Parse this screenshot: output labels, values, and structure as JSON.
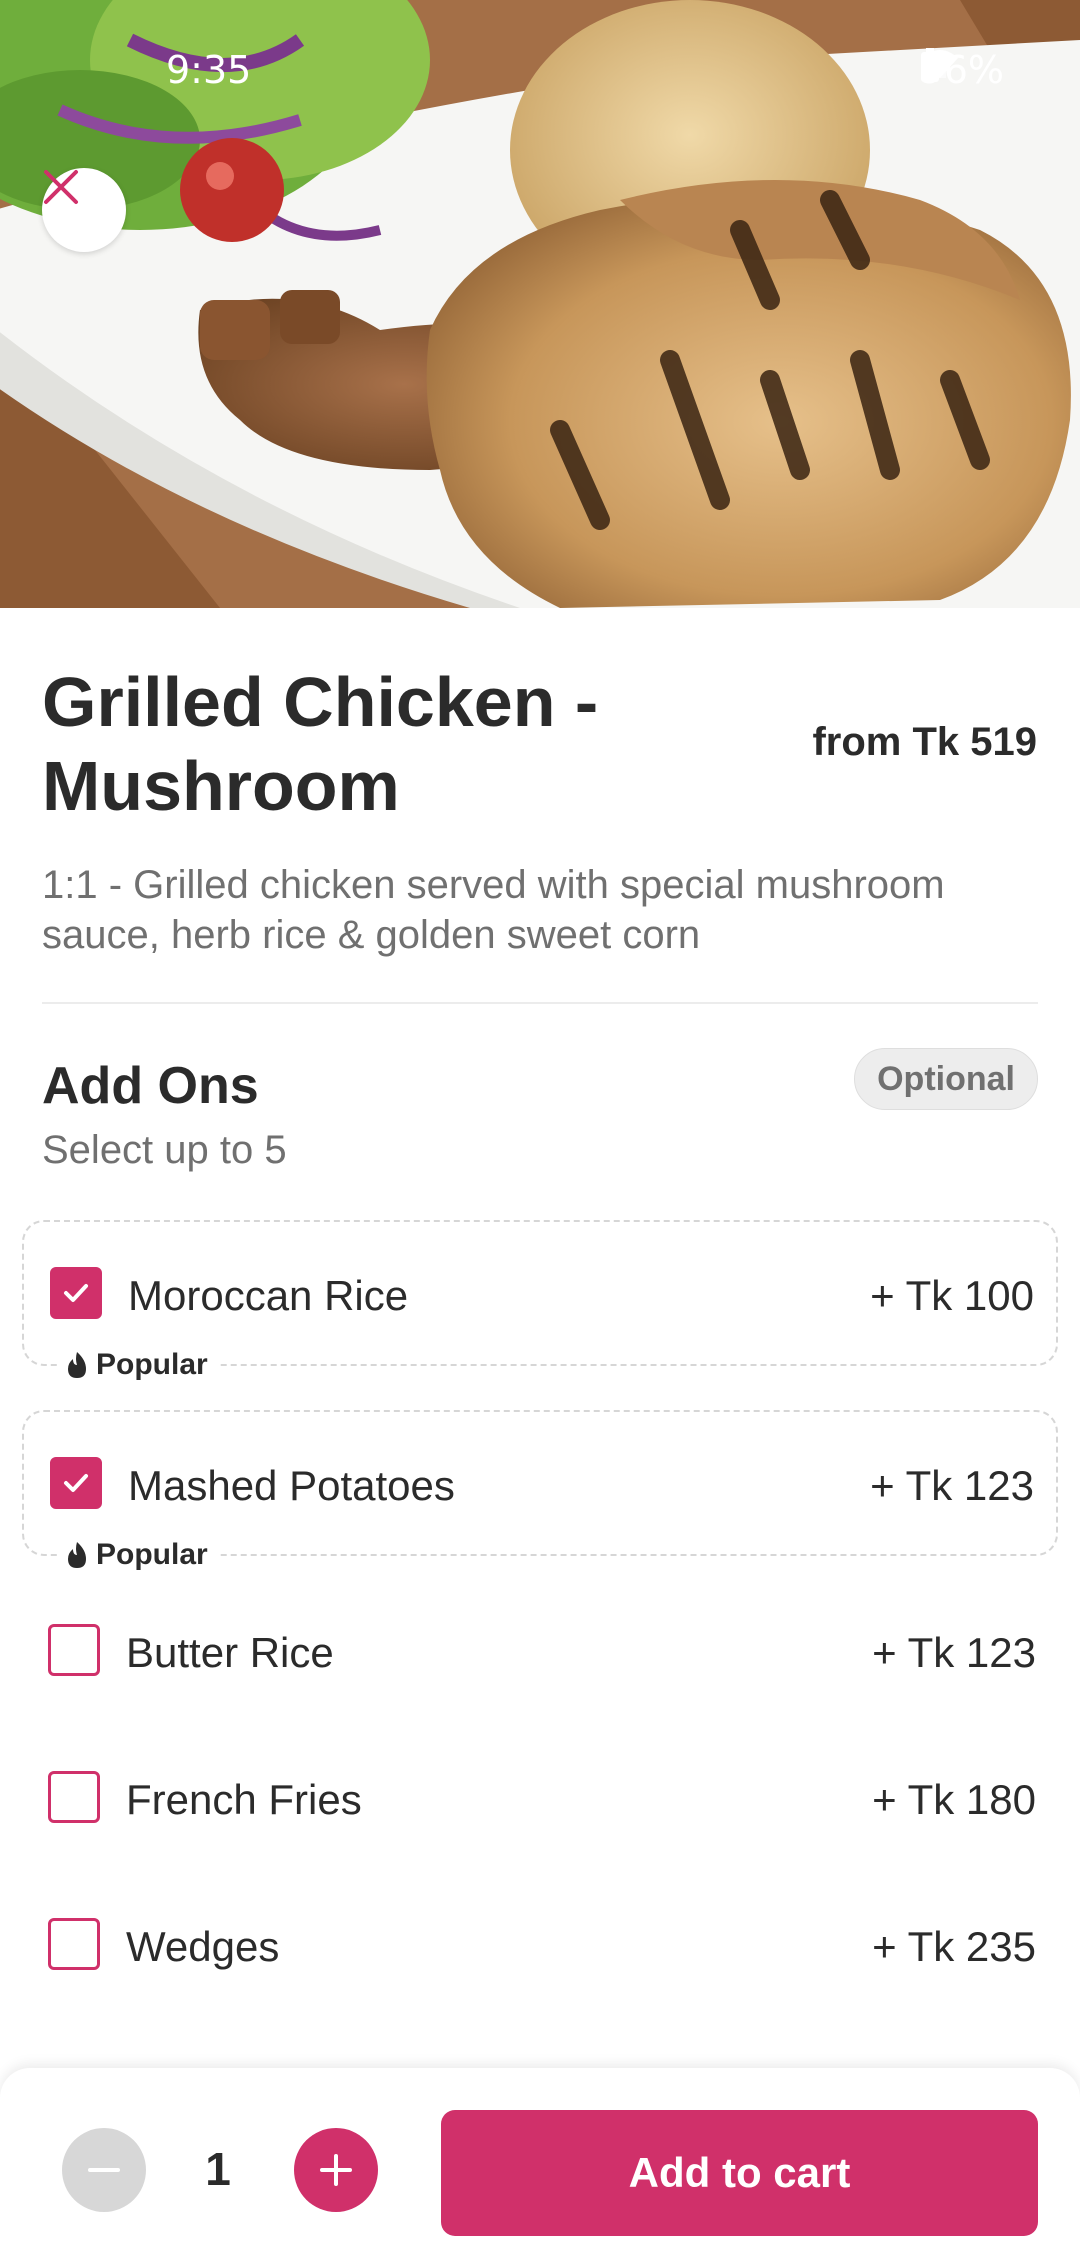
{
  "status_bar": {
    "time": "9:35",
    "battery": "96%"
  },
  "product": {
    "title": "Grilled Chicken - Mushroom",
    "price_from": "from Tk 519",
    "description": "1:1 - Grilled chicken served with special mushroom sauce, herb rice & golden sweet corn"
  },
  "addons": {
    "title": "Add Ons",
    "subtitle": "Select up to 5",
    "badge": "Optional",
    "popular_label": "Popular",
    "items": [
      {
        "name": "Moroccan Rice",
        "price": "+ Tk 100",
        "checked": true,
        "popular": true
      },
      {
        "name": "Mashed Potatoes",
        "price": "+ Tk 123",
        "checked": true,
        "popular": true
      },
      {
        "name": "Butter Rice",
        "price": "+ Tk 123",
        "checked": false,
        "popular": false
      },
      {
        "name": "French Fries",
        "price": "+ Tk 180",
        "checked": false,
        "popular": false
      },
      {
        "name": "Wedges",
        "price": "+ Tk 235",
        "checked": false,
        "popular": false
      }
    ]
  },
  "cart": {
    "quantity": "1",
    "add_label": "Add to cart"
  },
  "colors": {
    "accent": "#d0306a",
    "text": "#2b2b2b",
    "muted": "#707070"
  }
}
